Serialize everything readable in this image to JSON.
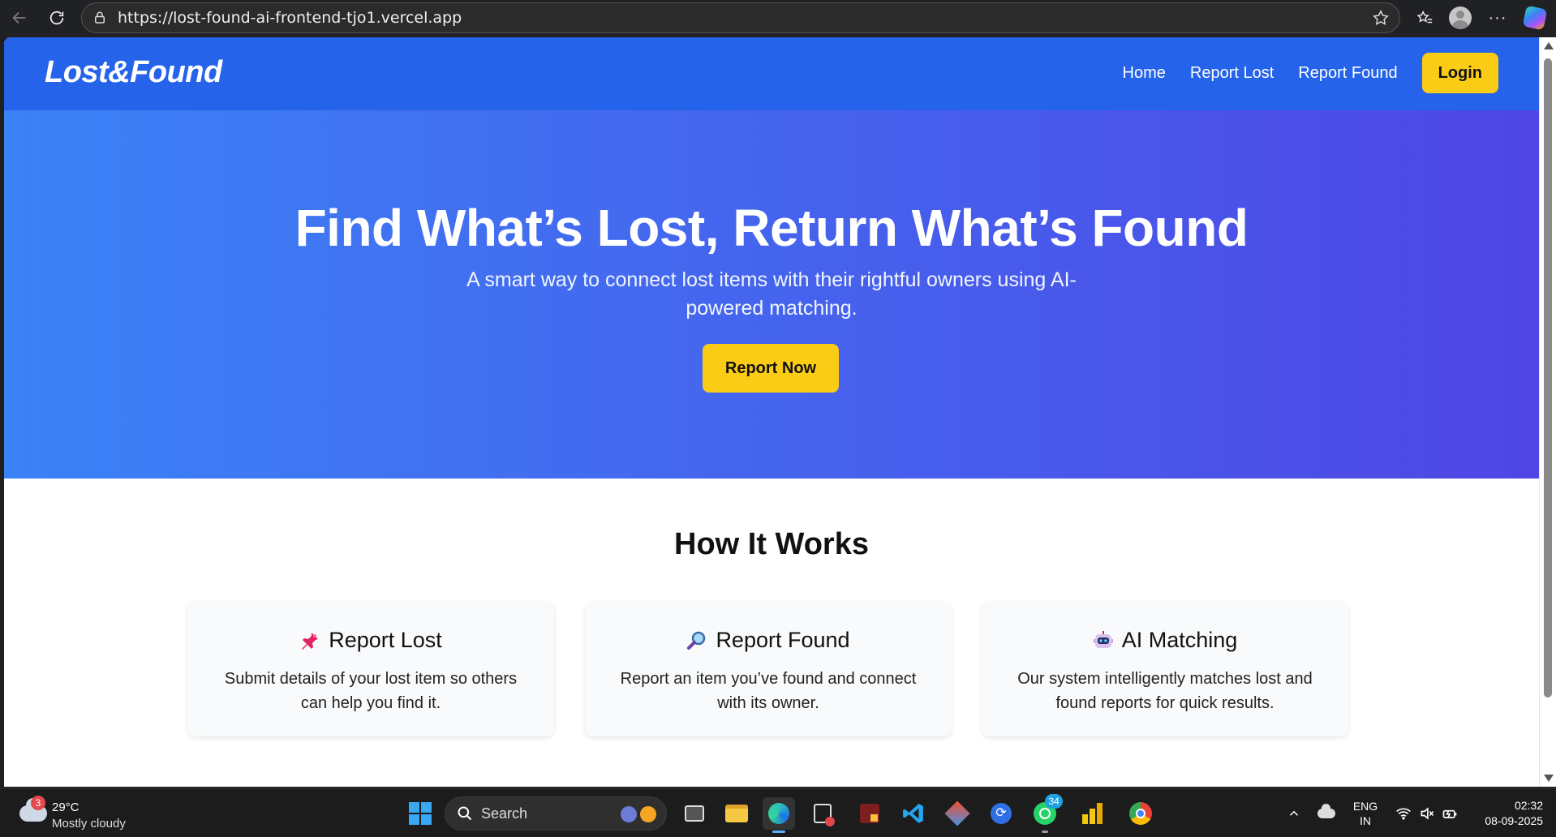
{
  "browser": {
    "url": "https://lost-found-ai-frontend-tjo1.vercel.app"
  },
  "site": {
    "logo": "Lost&Found",
    "nav": {
      "home": "Home",
      "report_lost": "Report Lost",
      "report_found": "Report Found",
      "login": "Login"
    },
    "colors": {
      "nav_bg": "#2563eb",
      "hero_start": "#3b82f6",
      "hero_end": "#4f46e5",
      "accent": "#facc15"
    }
  },
  "hero": {
    "title": "Find What’s Lost, Return What’s Found",
    "subtitle": "A smart way to connect lost items with their rightful owners using AI-powered matching.",
    "cta": "Report Now"
  },
  "how_it_works": {
    "title": "How It Works",
    "cards": [
      {
        "icon": "pushpin-icon",
        "title": "Report Lost",
        "description": "Submit details of your lost item so others can help you find it."
      },
      {
        "icon": "magnifier-icon",
        "title": "Report Found",
        "description": "Report an item you’ve found and connect with its owner."
      },
      {
        "icon": "robot-icon",
        "title": "AI Matching",
        "description": "Our system intelligently matches lost and found reports for quick results."
      }
    ]
  },
  "taskbar": {
    "weather_badge": "3",
    "temperature": "29°C",
    "condition": "Mostly cloudy",
    "search_label": "Search",
    "whatsapp_badge": "34",
    "language_line1": "ENG",
    "language_line2": "IN",
    "time": "02:32",
    "date": "08-09-2025"
  }
}
